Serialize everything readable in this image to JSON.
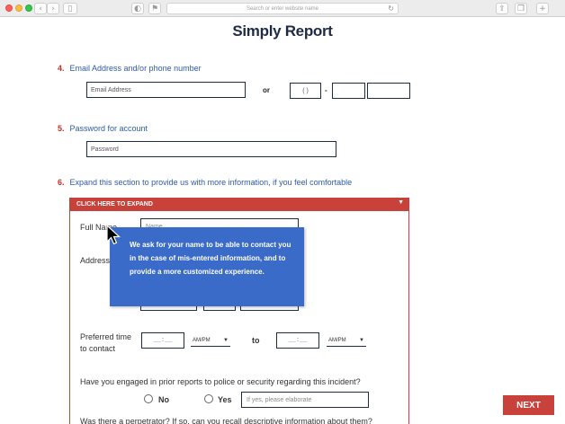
{
  "browser": {
    "address_placeholder": "Search or enter website name",
    "icons": [
      "back-icon",
      "forward-icon",
      "sidebar-icon",
      "shield-icon",
      "tab-icon",
      "reload-icon",
      "share-icon",
      "tabs-icon",
      "new-tab-icon"
    ]
  },
  "page": {
    "title": "Simply Report",
    "q4": {
      "num": "4.",
      "label": "Email Address and/or phone number",
      "email_placeholder": "Email Address",
      "or": "or",
      "phone_area": "(     )",
      "phone_dash": "-"
    },
    "q5": {
      "num": "5.",
      "label": "Password for account",
      "password_placeholder": "Password"
    },
    "q6": {
      "num": "6.",
      "label": "Expand this section to provide us with more information, if you feel comfortable",
      "expand_label": "CLICK HERE TO EXPAND",
      "full_name_label": "Full Name",
      "name_placeholder": "Name",
      "address_label": "Address",
      "contact_label_1": "Preferred time",
      "contact_label_2": "to contact",
      "time_placeholder": "__:__",
      "ampm": "AM/PM",
      "to": "to",
      "prior_reports_question": "Have you engaged in prior reports to police or security regarding this incident?",
      "no_label": "No",
      "yes_label": "Yes",
      "elaborate_placeholder": "If yes, please elaborate",
      "perpetrator_question": "Was there a perpetrator? If so, can you recall descriptive information about them?"
    },
    "tooltip": "We ask for your name to be able to contact you in the case of mis-entered information, and to provide a more customized experience.",
    "next_label": "NEXT"
  },
  "colors": {
    "accent_red": "#c9413b",
    "label_blue": "#2e5aa8",
    "tooltip_blue": "#3a6bc8",
    "title_navy": "#1f2a44"
  }
}
